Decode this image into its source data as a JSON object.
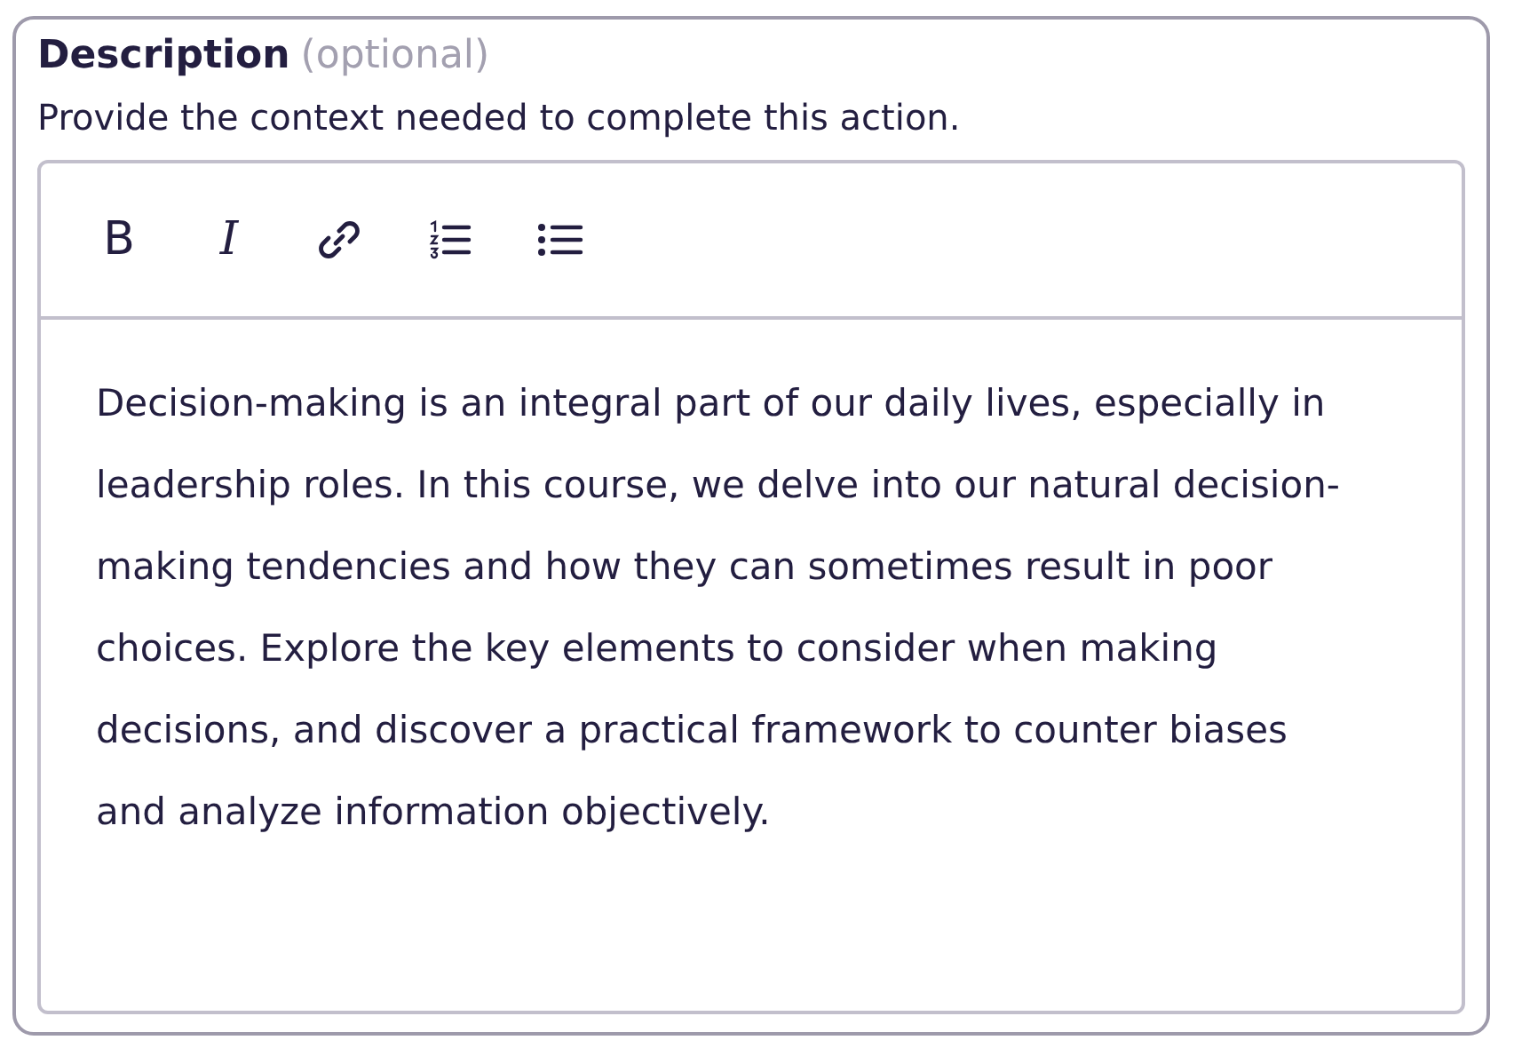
{
  "field": {
    "label": "Description",
    "optional_note": "(optional)",
    "help_text": "Provide the context needed to complete this action."
  },
  "toolbar": [
    {
      "kind": "bold",
      "label": "B"
    },
    {
      "kind": "italic",
      "label": "I"
    },
    {
      "kind": "link"
    },
    {
      "kind": "ordered-list"
    },
    {
      "kind": "bullet-list"
    }
  ],
  "editor": {
    "value": "Decision-making is an integral part of our daily lives, especially in leadership roles. In this course, we delve into our natural decision-making tendencies and how they can sometimes result in poor choices. Explore the key elements to consider when making decisions, and discover a practical framework to counter biases and analyze information objectively."
  }
}
